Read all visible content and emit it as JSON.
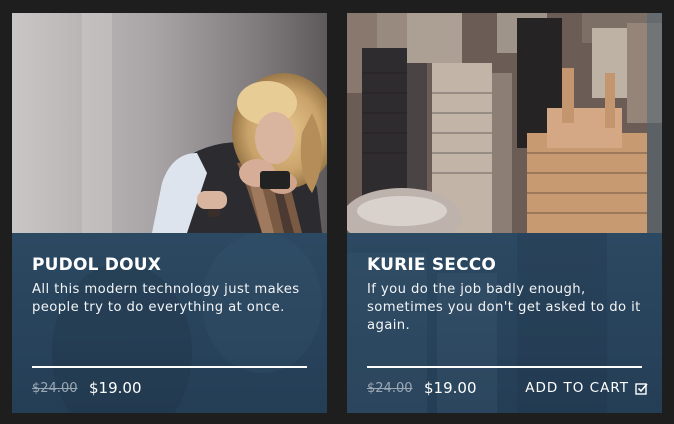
{
  "products": [
    {
      "name": "PUDOL DOUX",
      "description": "All this modern technology just makes people try to do everything at once.",
      "old_price": "$24.00",
      "price": "$19.00"
    },
    {
      "name": "KURIE SECCO",
      "description": "If you do the job badly enough, sometimes you don't get asked to do it again.",
      "old_price": "$24.00",
      "price": "$19.00",
      "cart_label": "ADD TO CART",
      "cart_icon": "checkbox-check-icon"
    }
  ],
  "colors": {
    "page_background": "#1e1e1e",
    "panel_blue": "#2c4a64",
    "text_white": "#ffffff",
    "old_price_gray": "#9aa8b4"
  }
}
